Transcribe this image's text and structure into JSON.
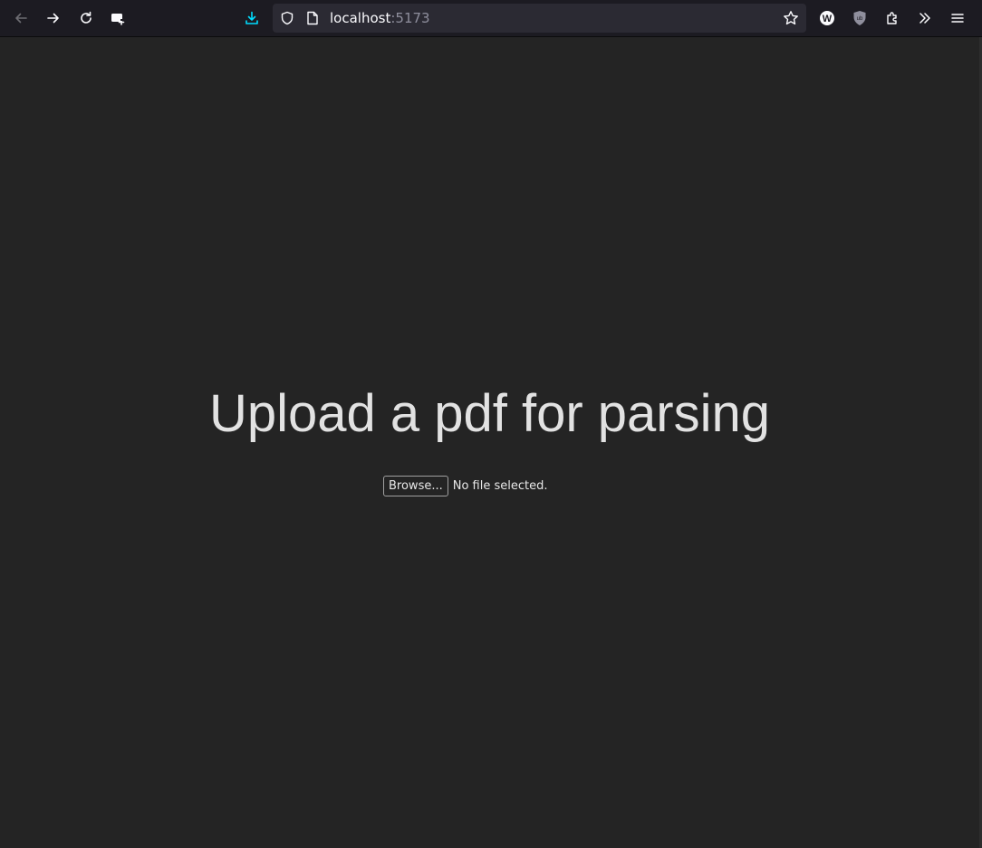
{
  "browser": {
    "url_host": "localhost",
    "url_port": ":5173",
    "colors": {
      "toolbar_bg": "#1c1b22",
      "urlbar_bg": "#2b2a33",
      "download_accent": "#00ddff"
    },
    "icons": {
      "back": "arrow-left",
      "forward": "arrow-right",
      "reload": "reload",
      "screenshot": "screenshot",
      "downloads": "download-arrow",
      "tracking_protection": "shield",
      "page_info": "page",
      "bookmark": "star",
      "wikiwand_extension": "W",
      "ublock_extension": "ublock-shield",
      "extensions": "puzzle",
      "overflow": "double-chevron",
      "menu": "hamburger"
    }
  },
  "page": {
    "background": "#242424",
    "title": "Upload a pdf for parsing",
    "file_input": {
      "button_label": "Browse...",
      "status_text": "No file selected."
    }
  }
}
